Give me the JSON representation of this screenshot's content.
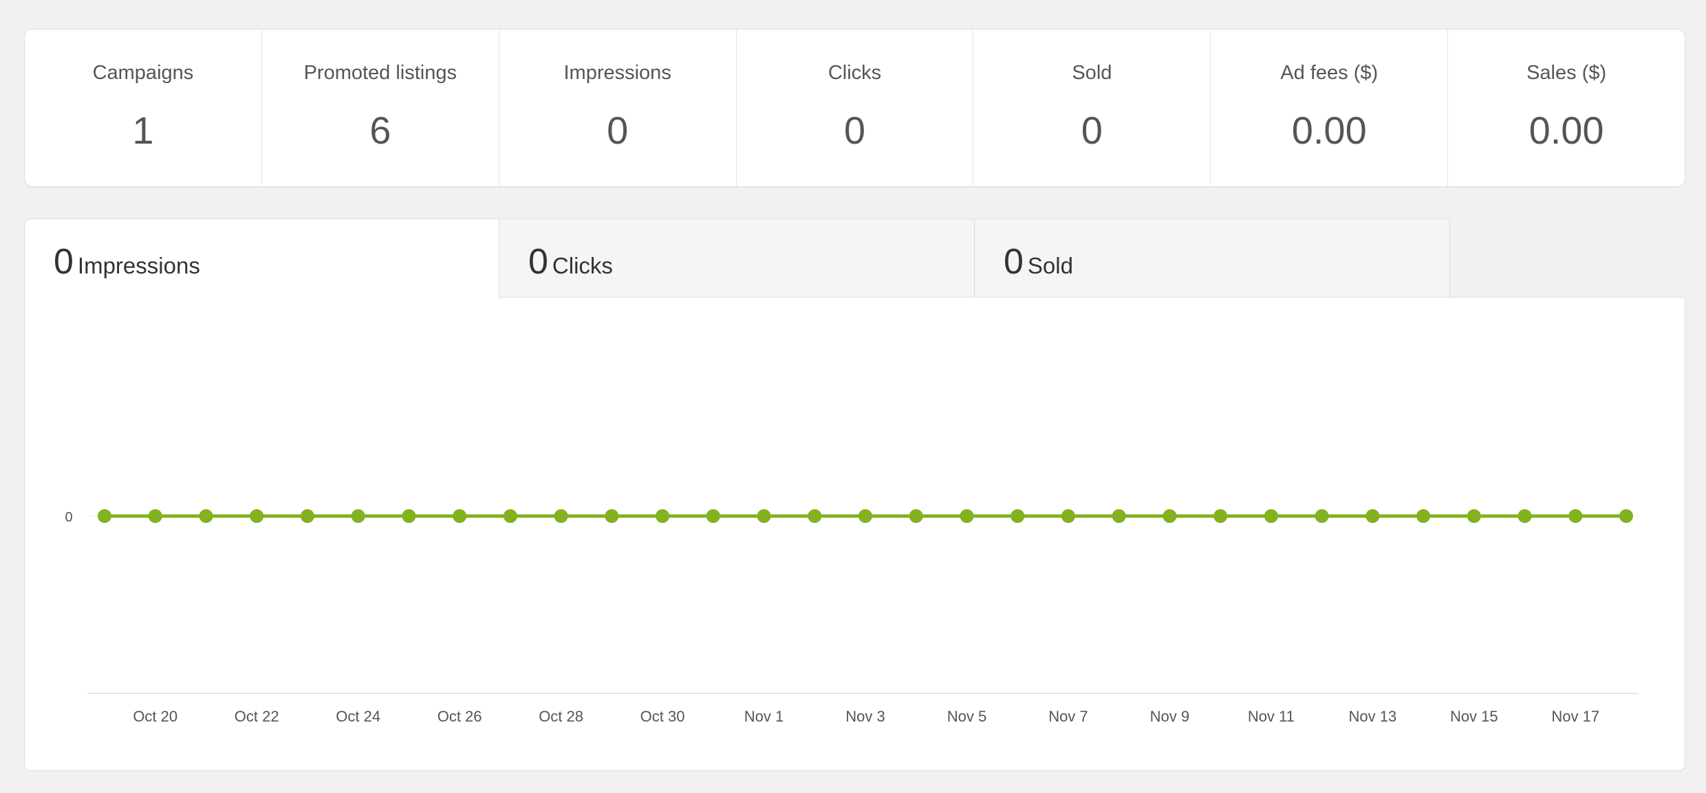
{
  "summary": {
    "campaigns": {
      "label": "Campaigns",
      "value": "1"
    },
    "promoted_listings": {
      "label": "Promoted listings",
      "value": "6"
    },
    "impressions": {
      "label": "Impressions",
      "value": "0"
    },
    "clicks": {
      "label": "Clicks",
      "value": "0"
    },
    "sold": {
      "label": "Sold",
      "value": "0"
    },
    "ad_fees": {
      "label": "Ad fees ($)",
      "value": "0.00"
    },
    "sales": {
      "label": "Sales ($)",
      "value": "0.00"
    }
  },
  "tabs": [
    {
      "count": "0",
      "label": "Impressions",
      "active": true
    },
    {
      "count": "0",
      "label": "Clicks",
      "active": false
    },
    {
      "count": "0",
      "label": "Sold",
      "active": false
    }
  ],
  "colors": {
    "series": "#82b21f",
    "axis_text": "#555555"
  },
  "chart_data": {
    "type": "line",
    "title": "",
    "xlabel": "",
    "ylabel": "",
    "y_ticks": [
      "0"
    ],
    "x_tick_labels": [
      "Oct 20",
      "Oct 22",
      "Oct 24",
      "Oct 26",
      "Oct 28",
      "Oct 30",
      "Nov 1",
      "Nov 3",
      "Nov 5",
      "Nov 7",
      "Nov 9",
      "Nov 11",
      "Nov 13",
      "Nov 15",
      "Nov 17"
    ],
    "x": [
      "Oct 19",
      "Oct 20",
      "Oct 21",
      "Oct 22",
      "Oct 23",
      "Oct 24",
      "Oct 25",
      "Oct 26",
      "Oct 27",
      "Oct 28",
      "Oct 29",
      "Oct 30",
      "Oct 31",
      "Nov 1",
      "Nov 2",
      "Nov 3",
      "Nov 4",
      "Nov 5",
      "Nov 6",
      "Nov 7",
      "Nov 8",
      "Nov 9",
      "Nov 10",
      "Nov 11",
      "Nov 12",
      "Nov 13",
      "Nov 14",
      "Nov 15",
      "Nov 16",
      "Nov 17",
      "Nov 18"
    ],
    "series": [
      {
        "values": [
          0,
          0,
          0,
          0,
          0,
          0,
          0,
          0,
          0,
          0,
          0,
          0,
          0,
          0,
          0,
          0,
          0,
          0,
          0,
          0,
          0,
          0,
          0,
          0,
          0,
          0,
          0,
          0,
          0,
          0,
          0
        ]
      }
    ],
    "grid": false,
    "legend": "none"
  }
}
